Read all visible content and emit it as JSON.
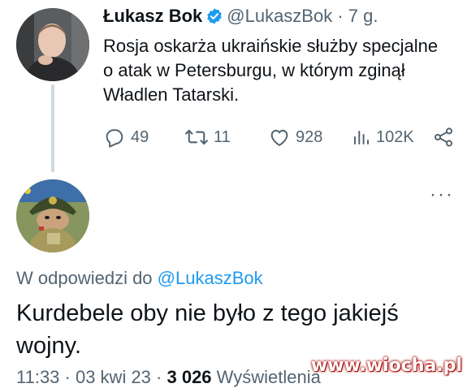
{
  "tweet": {
    "author_name": "Łukasz Bok",
    "handle": "@LukaszBok",
    "time": "· 7 g.",
    "text": "Rosja oskarża ukraińskie służby specjalne o atak w Petersburgu, w którym zginął Władlen Tatarski.",
    "replies": "49",
    "retweets": "11",
    "likes": "928",
    "views": "102K"
  },
  "reply": {
    "reply_to_prefix": "W odpowiedzi do",
    "reply_to_handle": "@LukaszBok",
    "text": "Kurdebele oby nie było z tego jakiejś wojny.",
    "timestamp": "11:33 · 03 kwi 23 ·",
    "views_count": "3 026",
    "views_label": "Wyświetlenia"
  },
  "more_menu": "···",
  "watermark": "www.wiocha.pl",
  "colors": {
    "accent": "#1d9bf0",
    "text": "#0f1419",
    "secondary": "#536471"
  }
}
